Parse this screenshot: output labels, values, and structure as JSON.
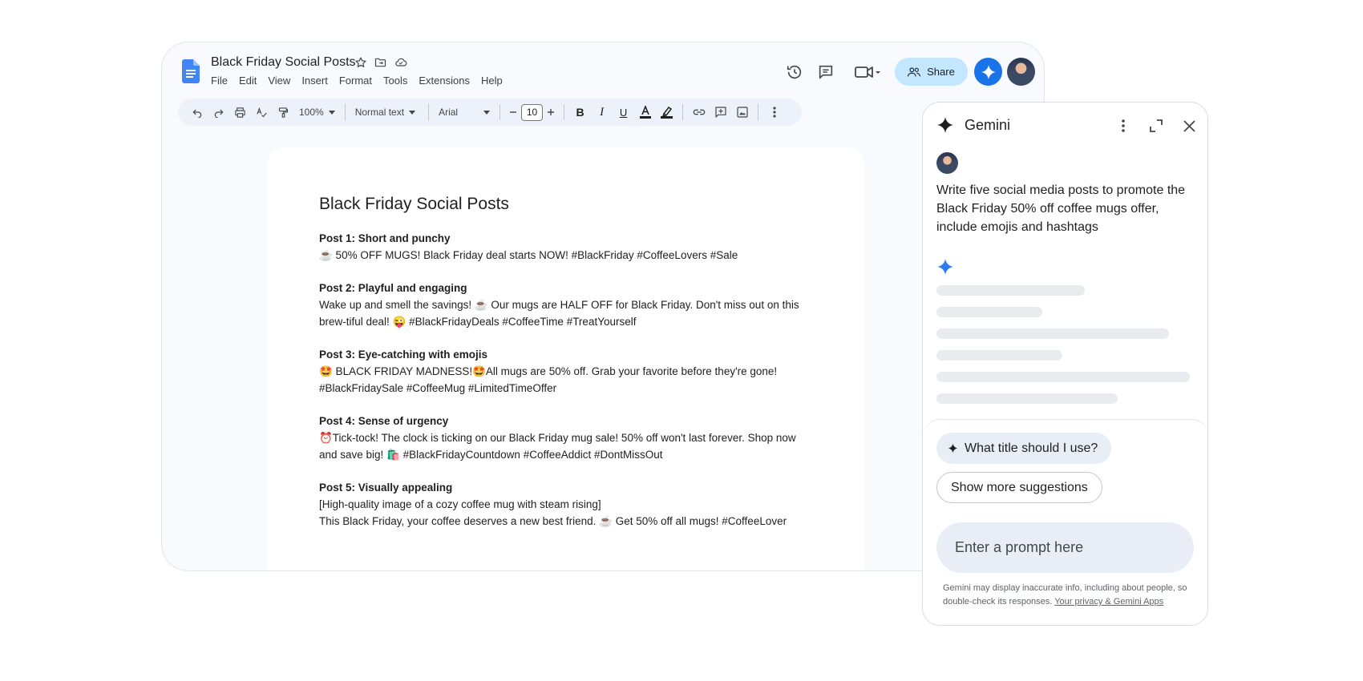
{
  "docs": {
    "title": "Black Friday Social Posts",
    "menu": [
      "File",
      "Edit",
      "View",
      "Insert",
      "Format",
      "Tools",
      "Extensions",
      "Help"
    ],
    "share_label": "Share",
    "toolbar": {
      "zoom": "100%",
      "style": "Normal text",
      "font": "Arial",
      "font_size": "10"
    }
  },
  "document": {
    "heading": "Black Friday Social Posts",
    "posts": [
      {
        "title": "Post 1: Short and punchy",
        "lines": [
          "☕ 50% OFF MUGS! Black Friday deal starts NOW! #BlackFriday #CoffeeLovers #Sale"
        ]
      },
      {
        "title": "Post 2: Playful and engaging",
        "lines": [
          "Wake up and smell the savings! ☕ Our mugs are HALF OFF for Black Friday. Don't miss out on this",
          "brew-tiful deal! 😜 #BlackFridayDeals #CoffeeTime #TreatYourself"
        ]
      },
      {
        "title": "Post 3: Eye-catching with emojis",
        "lines": [
          "🤩 BLACK FRIDAY MADNESS!🤩All mugs are 50% off. Grab your favorite before they're gone!",
          "#BlackFridaySale #CoffeeMug #LimitedTimeOffer"
        ]
      },
      {
        "title": "Post 4: Sense of urgency",
        "lines": [
          "⏰Tick-tock! The clock is ticking on our Black Friday mug sale! 50% off won't last forever. Shop now",
          "and save big! 🛍️ #BlackFridayCountdown #CoffeeAddict #DontMissOut"
        ]
      },
      {
        "title": "Post 5: Visually appealing",
        "lines": [
          "[High-quality image of a cozy coffee mug with steam rising]",
          "This Black Friday, your coffee deserves a new best friend. ☕ Get 50% off all mugs! #CoffeeLover"
        ]
      }
    ]
  },
  "gemini": {
    "title": "Gemini",
    "user_prompt": "Write five social media posts to promote the Black Friday 50% off coffee mugs offer, include emojis and hashtags",
    "suggestion": "What title should I use?",
    "more_suggestions": "Show more suggestions",
    "input_placeholder": "Enter a prompt here",
    "disclaimer": "Gemini may display inaccurate info, including about people, so double-check its responses.",
    "privacy_link": "Your privacy & Gemini Apps"
  },
  "colors": {
    "accent": "#1a73e8",
    "share_bg": "#c2e7ff",
    "app_bg": "#f8fafd",
    "toolbar_bg": "#edf2fa",
    "skeleton": "#e9ebee"
  },
  "icons": [
    "docs-logo-icon",
    "star-icon",
    "move-folder-icon",
    "cloud-status-icon",
    "history-icon",
    "comment-icon",
    "meet-icon",
    "people-icon",
    "gemini-spark-icon",
    "undo-icon",
    "redo-icon",
    "print-icon",
    "spellcheck-icon",
    "paint-format-icon",
    "bold-icon",
    "italic-icon",
    "underline-icon",
    "text-color-icon",
    "highlight-icon",
    "link-icon",
    "add-comment-icon",
    "image-icon",
    "more-icon",
    "kebab-menu-icon",
    "expand-icon",
    "close-icon"
  ]
}
